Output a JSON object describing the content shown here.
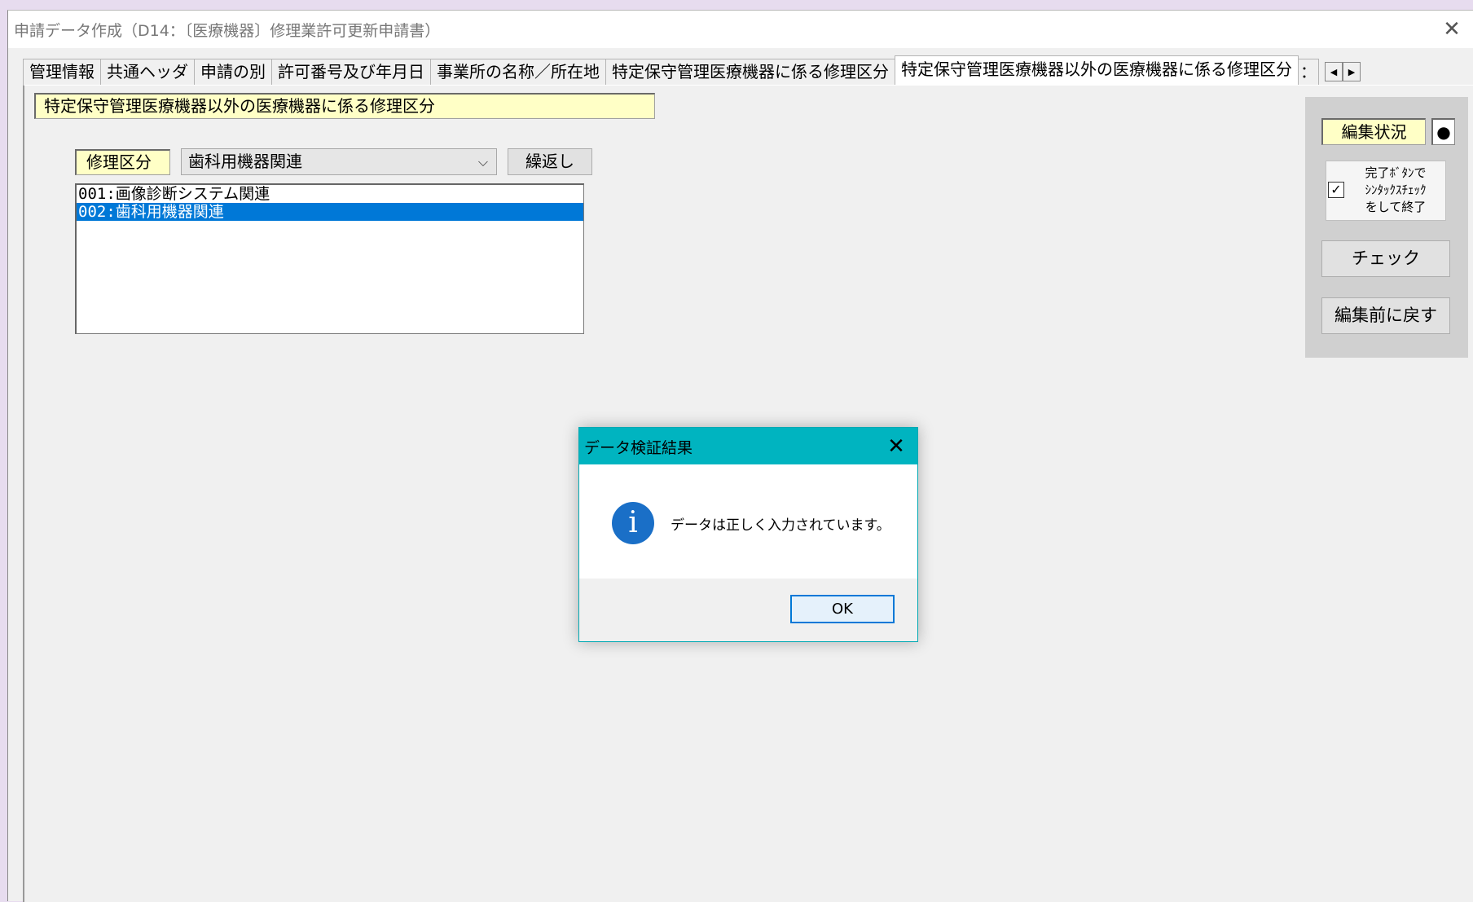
{
  "window": {
    "title": "申請データ作成（D14：〔医療機器〕修理業許可更新申請書）",
    "close_glyph": "✕"
  },
  "tabs": [
    {
      "label": "管理情報",
      "active": false
    },
    {
      "label": "共通ヘッダ",
      "active": false
    },
    {
      "label": "申請の別",
      "active": false
    },
    {
      "label": "許可番号及び年月日",
      "active": false
    },
    {
      "label": "事業所の名称／所在地",
      "active": false
    },
    {
      "label": "特定保守管理医療機器に係る修理区分",
      "active": false
    },
    {
      "label": "特定保守管理医療機器以外の医療機器に係る修理区分",
      "active": true
    },
    {
      "label": "：",
      "active": false
    }
  ],
  "tab_scroll": {
    "left": "◀",
    "right": "▶"
  },
  "form": {
    "section_title": "特定保守管理医療機器以外の医療機器に係る修理区分",
    "repair_label": "修理区分",
    "repair_select_value": "歯科用機器関連",
    "repeat_button": "繰返し",
    "list_items": [
      {
        "label": "001:画像診断システム関連",
        "selected": false
      },
      {
        "label": "002:歯科用機器関連",
        "selected": true
      }
    ]
  },
  "side_panel": {
    "edit_status_label": "編集状況",
    "edit_status_indicator": "●",
    "finish_checkbox_checked": true,
    "finish_checkbox_mark": "✓",
    "finish_text_line1": "完了ﾎﾞﾀﾝで",
    "finish_text_line2": "ｼﾝﾀｯｸｽﾁｪｯｸ",
    "finish_text_line3": "をして終了",
    "check_button": "チェック",
    "revert_button": "編集前に戻す"
  },
  "dialog": {
    "title": "データ検証結果",
    "close_glyph": "✕",
    "icon": "info-icon",
    "icon_glyph": "i",
    "message": "データは正しく入力されています。",
    "ok_button": "OK"
  },
  "colors": {
    "accent_dialog_titlebar": "#00b4c0",
    "selection": "#0078d7",
    "label_background": "#ffffc6",
    "info_icon": "#1a6fc7"
  }
}
